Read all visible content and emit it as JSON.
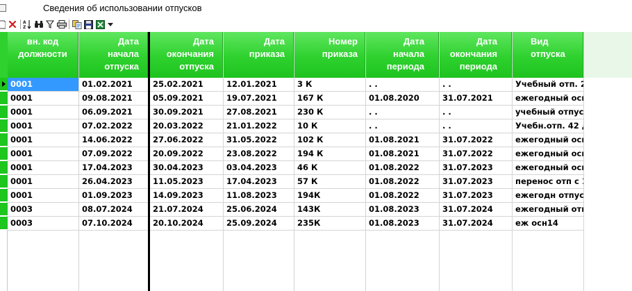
{
  "window": {
    "title": "Сведения об использовании отпусков",
    "icon": "table-icon"
  },
  "toolbar": {
    "items": [
      {
        "name": "new-doc-icon"
      },
      {
        "name": "delete-icon"
      },
      {
        "name": "sort-az-icon"
      },
      {
        "name": "find-icon"
      },
      {
        "name": "filter-icon"
      },
      {
        "name": "print-icon"
      },
      {
        "name": "copy-icon"
      },
      {
        "name": "save-icon"
      },
      {
        "name": "export-icon"
      },
      {
        "name": "dropdown-arrow-icon"
      }
    ]
  },
  "grid": {
    "columns": [
      {
        "key": "code",
        "header": [
          "вн. код",
          "должности"
        ],
        "align": "center"
      },
      {
        "key": "start",
        "header": [
          "Дата",
          "начала",
          "отпуска"
        ],
        "align": "right"
      },
      {
        "key": "end",
        "header": [
          "Дата",
          "окончания",
          "отпуска"
        ],
        "align": "right"
      },
      {
        "key": "order_date",
        "header": [
          "Дата",
          "приказа"
        ],
        "align": "right"
      },
      {
        "key": "order_no",
        "header": [
          "Номер",
          "приказа"
        ],
        "align": "right"
      },
      {
        "key": "period_start",
        "header": [
          "Дата",
          "начала",
          "периода"
        ],
        "align": "right"
      },
      {
        "key": "period_end",
        "header": [
          "Дата",
          "окончания",
          "периода"
        ],
        "align": "right"
      },
      {
        "key": "type",
        "header": [
          "Вид",
          "отпуска"
        ],
        "align": "left"
      }
    ],
    "rows": [
      {
        "code": "0001",
        "start": "01.02.2021",
        "end": "25.02.2021",
        "order_date": "12.01.2021",
        "order_no": "3 К",
        "period_start": ". .",
        "period_end": ". .",
        "type": "Учебный отп. 2"
      },
      {
        "code": "0001",
        "start": "09.08.2021",
        "end": "05.09.2021",
        "order_date": "19.07.2021",
        "order_no": "167 К",
        "period_start": "01.08.2020",
        "period_end": "31.07.2021",
        "type": "ежегодный осн"
      },
      {
        "code": "0001",
        "start": "06.09.2021",
        "end": "30.09.2021",
        "order_date": "27.08.2021",
        "order_no": "230 К",
        "period_start": ". .",
        "period_end": ". .",
        "type": "учебный отпус"
      },
      {
        "code": "0001",
        "start": "07.02.2022",
        "end": "20.03.2022",
        "order_date": "21.01.2022",
        "order_no": "10 К",
        "period_start": ". .",
        "period_end": ". .",
        "type": "Учебн.отп. 42 д"
      },
      {
        "code": "0001",
        "start": "14.06.2022",
        "end": "27.06.2022",
        "order_date": "31.05.2022",
        "order_no": "102 К",
        "period_start": "01.08.2021",
        "period_end": "31.07.2022",
        "type": "ежегодный осн"
      },
      {
        "code": "0001",
        "start": "07.09.2022",
        "end": "20.09.2022",
        "order_date": "23.08.2022",
        "order_no": "194 К",
        "period_start": "01.08.2021",
        "period_end": "31.07.2022",
        "type": "ежегодный осн"
      },
      {
        "code": "0001",
        "start": "17.04.2023",
        "end": "30.04.2023",
        "order_date": "03.04.2023",
        "order_no": "46 К",
        "period_start": "01.08.2022",
        "period_end": "31.07.2023",
        "type": "ежегодный осн"
      },
      {
        "code": "0001",
        "start": "26.04.2023",
        "end": "11.05.2023",
        "order_date": "17.04.2023",
        "order_no": "57 К",
        "period_start": "01.08.2022",
        "period_end": "31.07.2023",
        "type": "перенос отп с 1"
      },
      {
        "code": "0001",
        "start": "01.09.2023",
        "end": "14.09.2023",
        "order_date": "11.08.2023",
        "order_no": "194К",
        "period_start": "01.08.2022",
        "period_end": "31.07.2023",
        "type": "ежегодн отпуск"
      },
      {
        "code": "0003",
        "start": "08.07.2024",
        "end": "21.07.2024",
        "order_date": "25.06.2024",
        "order_no": "143К",
        "period_start": "01.08.2023",
        "period_end": "31.07.2024",
        "type": "ежегодный отп"
      },
      {
        "code": "0003",
        "start": "07.10.2024",
        "end": "20.10.2024",
        "order_date": "25.09.2024",
        "order_no": "235К",
        "period_start": "01.08.2023",
        "period_end": "31.07.2024",
        "type": "еж осн14"
      }
    ],
    "selected_row": 0,
    "selected_col": "code",
    "colors": {
      "header": "#2ed12e",
      "header_text": "#ffffff",
      "selection": "#3399ff",
      "grid_line": "#d4d4d4"
    }
  }
}
